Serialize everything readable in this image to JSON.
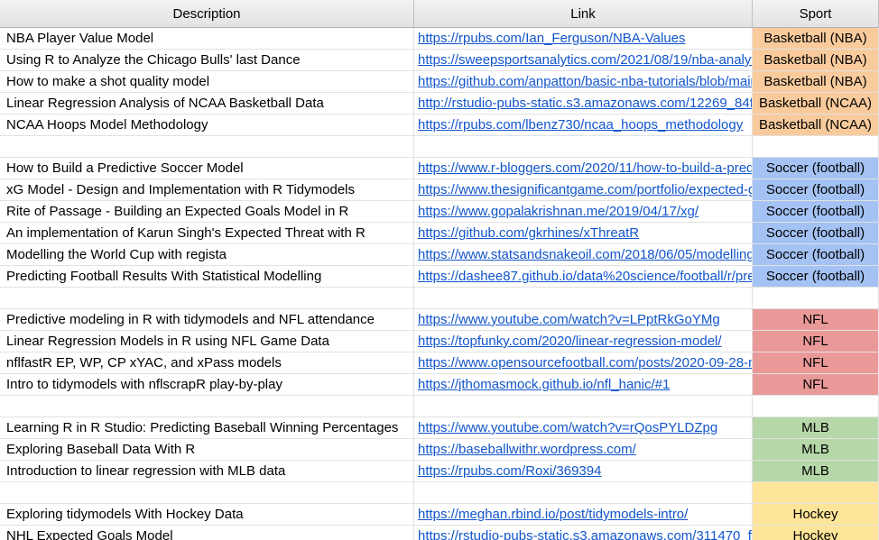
{
  "headers": {
    "description": "Description",
    "link": "Link",
    "sport": "Sport"
  },
  "colors": {
    "Basketball (NBA)": "#f9cb9c",
    "Basketball (NCAA)": "#f9cb9c",
    "Soccer (football)": "#a4c2f4",
    "NFL": "#ea9999",
    "MLB": "#b6d7a8",
    "Hockey": "#ffe599"
  },
  "rows": [
    {
      "description": "NBA Player Value Model",
      "link": "https://rpubs.com/Ian_Ferguson/NBA-Values",
      "sport": "Basketball (NBA)"
    },
    {
      "description": "Using R to Analyze the Chicago Bulls' last Dance",
      "link": "https://sweepsportsanalytics.com/2021/08/19/nba-analyt",
      "sport": "Basketball (NBA)"
    },
    {
      "description": "How to make a shot quality model",
      "link": "https://github.com/anpatton/basic-nba-tutorials/blob/main",
      "sport": "Basketball (NBA)"
    },
    {
      "description": "Linear Regression Analysis of NCAA Basketball Data",
      "link": "http://rstudio-pubs-static.s3.amazonaws.com/12269_84f",
      "sport": "Basketball (NCAA)"
    },
    {
      "description": "NCAA Hoops Model Methodology",
      "link": "https://rpubs.com/lbenz730/ncaa_hoops_methodology",
      "sport": "Basketball (NCAA)"
    },
    {
      "description": "",
      "link": "",
      "sport": ""
    },
    {
      "description": "How to Build a Predictive Soccer Model",
      "link": "https://www.r-bloggers.com/2020/11/how-to-build-a-pred",
      "sport": "Soccer (football)"
    },
    {
      "description": "xG Model - Design and Implementation with R Tidymodels",
      "link": "https://www.thesignificantgame.com/portfolio/expected-g",
      "sport": "Soccer (football)"
    },
    {
      "description": "Rite of Passage - Building an Expected Goals Model in R",
      "link": "https://www.gopalakrishnan.me/2019/04/17/xg/",
      "sport": "Soccer (football)"
    },
    {
      "description": "An implementation of Karun Singh's Expected Threat with R",
      "link": "https://github.com/gkrhines/xThreatR",
      "sport": "Soccer (football)"
    },
    {
      "description": "Modelling the World Cup with regista",
      "link": "https://www.statsandsnakeoil.com/2018/06/05/modelling",
      "sport": "Soccer (football)"
    },
    {
      "description": "Predicting Football Results With Statistical Modelling",
      "link": "https://dashee87.github.io/data%20science/football/r/pre",
      "sport": "Soccer (football)"
    },
    {
      "description": "",
      "link": "",
      "sport": ""
    },
    {
      "description": "Predictive modeling in R with tidymodels and NFL attendance",
      "link": "https://www.youtube.com/watch?v=LPptRkGoYMg",
      "sport": "NFL"
    },
    {
      "description": "Linear Regression Models in R using NFL Game Data",
      "link": "https://topfunky.com/2020/linear-regression-model/",
      "sport": "NFL"
    },
    {
      "description": "nflfastR EP, WP, CP xYAC, and xPass models",
      "link": "https://www.opensourcefootball.com/posts/2020-09-28-n",
      "sport": "NFL"
    },
    {
      "description": "Intro to tidymodels with nflscrapR play-by-play",
      "link": "https://jthomasmock.github.io/nfl_hanic/#1",
      "sport": "NFL"
    },
    {
      "description": "",
      "link": "",
      "sport": ""
    },
    {
      "description": "Learning R in R Studio: Predicting Baseball Winning Percentages",
      "link": "https://www.youtube.com/watch?v=rQosPYLDZpg",
      "sport": "MLB"
    },
    {
      "description": "Exploring Baseball Data With R",
      "link": "https://baseballwithr.wordpress.com/",
      "sport": "MLB"
    },
    {
      "description": "Introduction to linear regression with MLB data",
      "link": "https://rpubs.com/Roxi/369394",
      "sport": "MLB"
    },
    {
      "description": "",
      "link": "",
      "sport": "",
      "sport_color": "Hockey"
    },
    {
      "description": "Exploring tidymodels With Hockey Data",
      "link": "https://meghan.rbind.io/post/tidymodels-intro/",
      "sport": "Hockey"
    },
    {
      "description": "NHL Expected Goals Model",
      "link": "https://rstudio-pubs-static.s3.amazonaws.com/311470_f",
      "sport": "Hockey"
    }
  ]
}
